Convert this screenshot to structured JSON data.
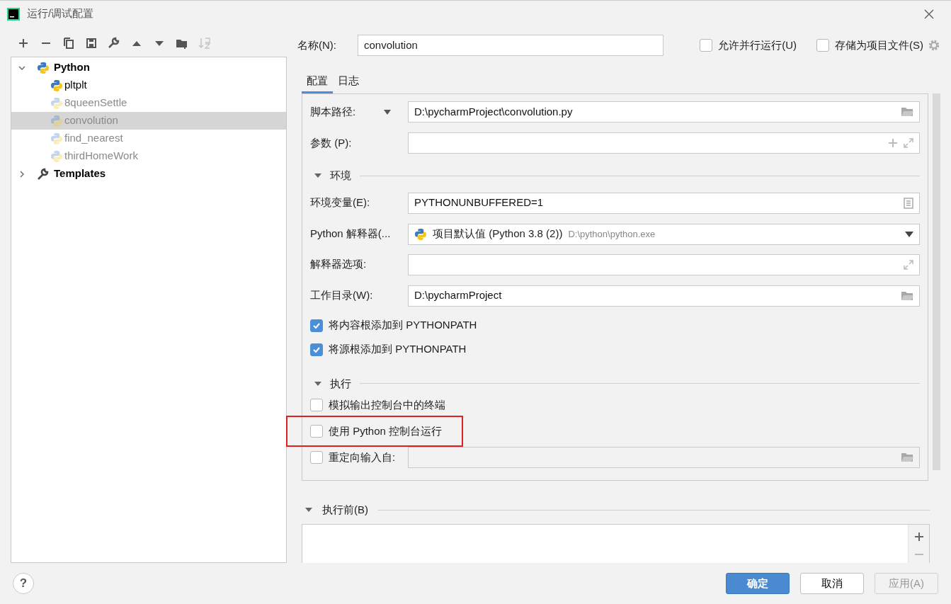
{
  "window": {
    "title": "运行/调试配置"
  },
  "toolbar": [
    {
      "kind": "add",
      "disabled": false
    },
    {
      "kind": "remove",
      "disabled": false
    },
    {
      "kind": "copy",
      "disabled": false
    },
    {
      "kind": "save",
      "disabled": false
    },
    {
      "kind": "edit",
      "disabled": false
    },
    {
      "kind": "up",
      "disabled": false
    },
    {
      "kind": "down",
      "disabled": false
    },
    {
      "kind": "folder",
      "disabled": false
    },
    {
      "kind": "sort",
      "disabled": true
    }
  ],
  "tree": [
    {
      "label": "Python",
      "kind": "python",
      "expanded": true,
      "selected": false,
      "children": [
        {
          "label": "pltplt",
          "temporary": false,
          "selected": false
        },
        {
          "label": "8queenSettle",
          "temporary": true,
          "selected": false
        },
        {
          "label": "convolution",
          "temporary": true,
          "selected": true
        },
        {
          "label": "find_nearest",
          "temporary": true,
          "selected": false
        },
        {
          "label": "thirdHomeWork",
          "temporary": true,
          "selected": false
        }
      ]
    },
    {
      "label": "Templates",
      "kind": "templates",
      "expanded": false,
      "selected": false
    }
  ],
  "name_field": {
    "label": "名称(N):",
    "value": "convolution"
  },
  "top_options": [
    {
      "label": "允许并行运行(U)",
      "checked": false
    },
    {
      "label": "存储为项目文件(S)",
      "checked": false
    }
  ],
  "tabs": [
    {
      "label": "配置",
      "selected": true
    },
    {
      "label": "日志",
      "selected": false
    }
  ],
  "rows": [
    {
      "kind": "script",
      "label": "脚本路径:",
      "value": "D:\\pycharmProject\\convolution.py"
    },
    {
      "kind": "args",
      "label": "参数 (P):"
    },
    {
      "kind": "section",
      "label": "环境",
      "expanded": true
    },
    {
      "kind": "env",
      "label": "环境变量(E):",
      "value": "PYTHONUNBUFFERED=1"
    },
    {
      "kind": "interpreter",
      "label": "Python 解释器(...",
      "value": "项目默认值 (Python 3.8 (2))",
      "detail": "D:\\python\\python.exe"
    },
    {
      "kind": "options",
      "label": "解释器选项:"
    },
    {
      "kind": "path",
      "label": "工作目录(W):",
      "value": "D:\\pycharmProject"
    },
    {
      "kind": "gap"
    },
    {
      "kind": "checkbox",
      "label": "将内容根添加到 PYTHONPATH",
      "checked": true,
      "highlighted": false
    },
    {
      "kind": "checkbox",
      "label": "将源根添加到 PYTHONPATH",
      "checked": true,
      "highlighted": false
    },
    {
      "kind": "section",
      "label": "执行",
      "expanded": true
    },
    {
      "kind": "checkbox",
      "label": "模拟输出控制台中的终端",
      "checked": false,
      "highlighted": false
    },
    {
      "kind": "checkbox",
      "label": "使用 Python 控制台运行",
      "checked": false,
      "highlighted": true
    },
    {
      "kind": "redirect",
      "label": "重定向输入自:",
      "checked": false
    }
  ],
  "before_launch": {
    "label": "执行前(B)",
    "expanded": true
  },
  "help": {
    "label": "?"
  },
  "buttons": [
    {
      "label": "确定",
      "kind": "primary",
      "disabled": false
    },
    {
      "label": "取消",
      "kind": "normal",
      "disabled": false
    },
    {
      "label": "应用(A)",
      "kind": "normal",
      "disabled": true
    }
  ]
}
